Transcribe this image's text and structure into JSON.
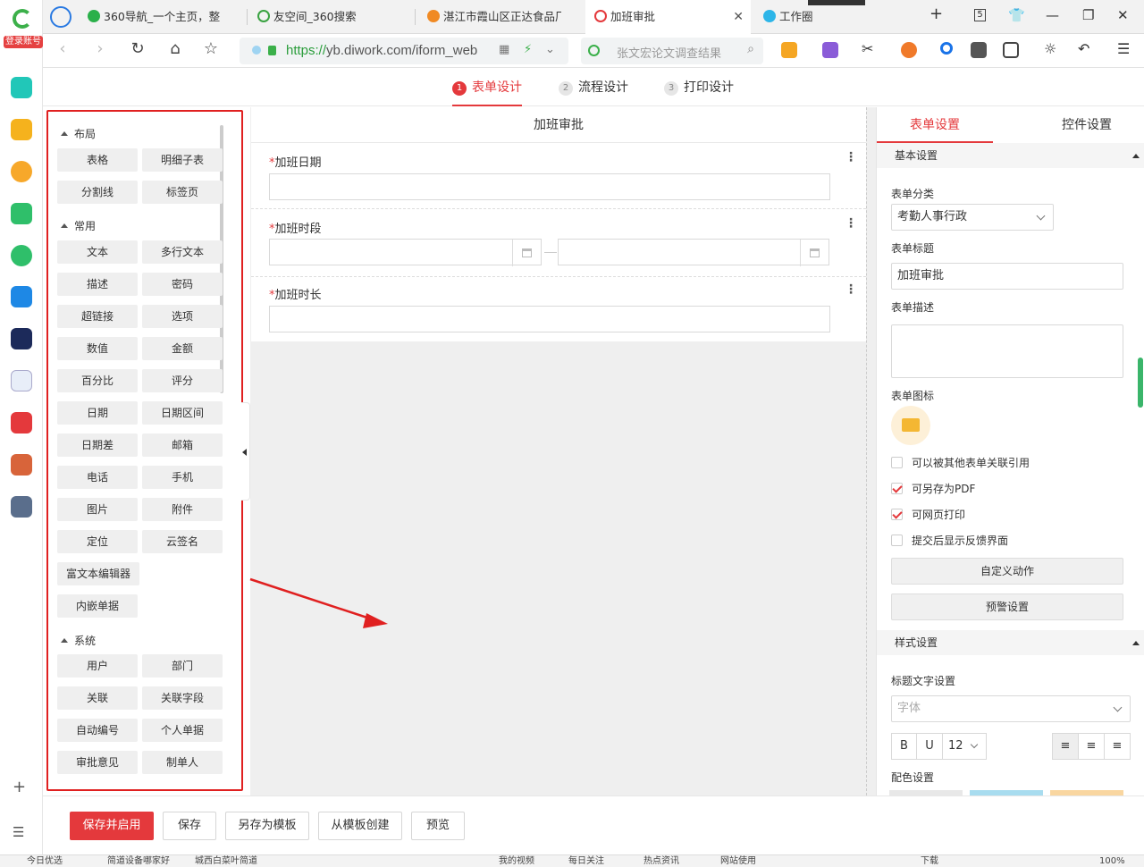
{
  "browser": {
    "rail_login_label": "登录账号",
    "tabs": [
      {
        "title": "360导航_一个主页，整",
        "icon_color": "#2bb04a"
      },
      {
        "title": "友空间_360搜索",
        "icon_color": "#3aa241"
      },
      {
        "title": "湛江市霞山区正达食品厂",
        "icon_color": "#f08a24"
      },
      {
        "title": "加班审批",
        "icon_color": "#e4393c",
        "active": true
      },
      {
        "title": "工作圈",
        "icon_color": "#2db5e8"
      }
    ],
    "tab_count": "5",
    "url_scheme": "https://",
    "url_rest": "yb.diwork.com/iform_web",
    "search_placeholder": "张文宏论文调查结果"
  },
  "steps": [
    {
      "num": "1",
      "label": "表单设计",
      "active": true
    },
    {
      "num": "2",
      "label": "流程设计"
    },
    {
      "num": "3",
      "label": "打印设计"
    }
  ],
  "palette": {
    "sections": [
      {
        "title": "布局",
        "items": [
          "表格",
          "明细子表",
          "分割线",
          "标签页"
        ]
      },
      {
        "title": "常用",
        "items": [
          "文本",
          "多行文本",
          "描述",
          "密码",
          "超链接",
          "选项",
          "数值",
          "金额",
          "百分比",
          "评分",
          "日期",
          "日期区间",
          "日期差",
          "邮箱",
          "电话",
          "手机",
          "图片",
          "附件",
          "定位",
          "云签名",
          "富文本编辑器",
          "内嵌单据"
        ]
      },
      {
        "title": "系统",
        "items": [
          "用户",
          "部门",
          "关联",
          "关联字段",
          "自动编号",
          "个人单据",
          "审批意见",
          "制单人"
        ]
      }
    ]
  },
  "canvas": {
    "form_title": "加班审批",
    "fields": [
      {
        "label": "加班日期",
        "required": "*"
      },
      {
        "label": "加班时段",
        "required": "*"
      },
      {
        "label": "加班时长",
        "required": "*"
      }
    ]
  },
  "right_panel": {
    "tabs": [
      "表单设置",
      "控件设置"
    ],
    "basic_section": "基本设置",
    "category_label": "表单分类",
    "category_value": "考勤人事行政",
    "title_label": "表单标题",
    "title_value": "加班审批",
    "desc_label": "表单描述",
    "icon_label": "表单图标",
    "checks": [
      {
        "label": "可以被其他表单关联引用",
        "checked": false
      },
      {
        "label": "可另存为PDF",
        "checked": true
      },
      {
        "label": "可网页打印",
        "checked": true
      },
      {
        "label": "提交后显示反馈界面",
        "checked": false
      }
    ],
    "custom_action": "自定义动作",
    "alert_settings": "预警设置",
    "style_section": "样式设置",
    "title_text_settings": "标题文字设置",
    "font_placeholder": "字体",
    "bold": "B",
    "underline": "U",
    "font_size": "12",
    "color_settings": "配色设置"
  },
  "actions": {
    "save_enable": "保存并启用",
    "save": "保存",
    "save_as_template": "另存为模板",
    "create_from_template": "从模板创建",
    "preview": "预览"
  },
  "statusbar": {
    "item1": "今日优选",
    "item2": "简道设备哪家好",
    "item3": "城西白菜叶简道",
    "item4": "我的视频",
    "item5": "每日关注",
    "item6": "热点资讯",
    "item7": "网站使用",
    "item8": "下载",
    "zoom": "100%"
  }
}
